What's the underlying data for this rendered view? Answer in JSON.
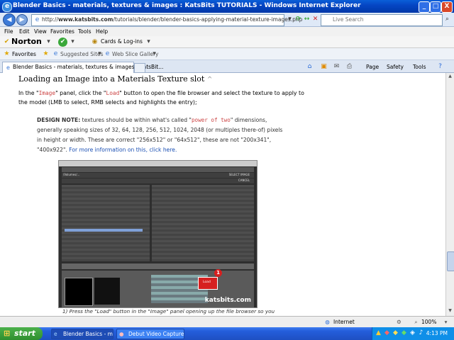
{
  "window": {
    "title": "Blender Basics - materials, textures & images : KatsBits TUTORIALS - Windows Internet Explorer",
    "controls": [
      "_",
      "□",
      "X"
    ]
  },
  "address": {
    "url_prefix": "http://",
    "url_domain": "www.katsbits.com",
    "url_path": "/tutorials/blender/blender-basics-applying-material-texture-images.php",
    "search_placeholder": "Live Search"
  },
  "menu": [
    "File",
    "Edit",
    "View",
    "Favorites",
    "Tools",
    "Help"
  ],
  "norton": {
    "logo": "Norton",
    "cards_label": "Cards & Log-ins"
  },
  "favorites_bar": {
    "favorites_label": "Favorites",
    "suggested_label": "Suggested Sites",
    "gallery_label": "Web Slice Gallery"
  },
  "tabs": [
    {
      "label": "Blender Basics - materials, textures & images : KatsBit..."
    }
  ],
  "command_bar": {
    "page": "Page",
    "safety": "Safety",
    "tools": "Tools"
  },
  "content": {
    "heading": "Loading an Image into a Materials Texture slot",
    "heading_caret": "^",
    "p1": {
      "t1": "In the \"",
      "code1": "Image",
      "t2": "\" panel, click the \"",
      "code2": "Load",
      "t3": "\" button to open the file browser and select the texture to apply to",
      "line2": "the model (LMB to select, RMB selects and highlights the entry);"
    },
    "note": {
      "label": "DESIGN NOTE:",
      "t1": " textures should be within what's called \"",
      "code": "power of two",
      "t2": "\" dimensions,",
      "line2": "generally speaking sizes of 32, 64, 128, 256, 512, 1024, 2048 (or multiples there-of) pixels",
      "line3": "in height or width. These are correct \"256x512\" or \"64x512\", these are not \"200x341\",",
      "line4_start": "\"400x922\". ",
      "link": "For more information on this, click here."
    },
    "screenshot": {
      "file_path": "/Volumes/...",
      "watermark": "katsbits.com",
      "marker": "1",
      "button_select": "SELECT IMAGE",
      "button_cancel": "CANCEL",
      "button_load": "Load"
    },
    "caption": "1) Press the \"Load\" button in the \"Image\" panel opening up the file browser so you"
  },
  "status": {
    "zone": "Internet",
    "zoom": "100%"
  },
  "taskbar": {
    "start": "start",
    "tasks": [
      {
        "label": "Blender Basics - mate..."
      },
      {
        "label": "Debut Video Capture ..."
      }
    ],
    "clock": "4:13 PM"
  }
}
